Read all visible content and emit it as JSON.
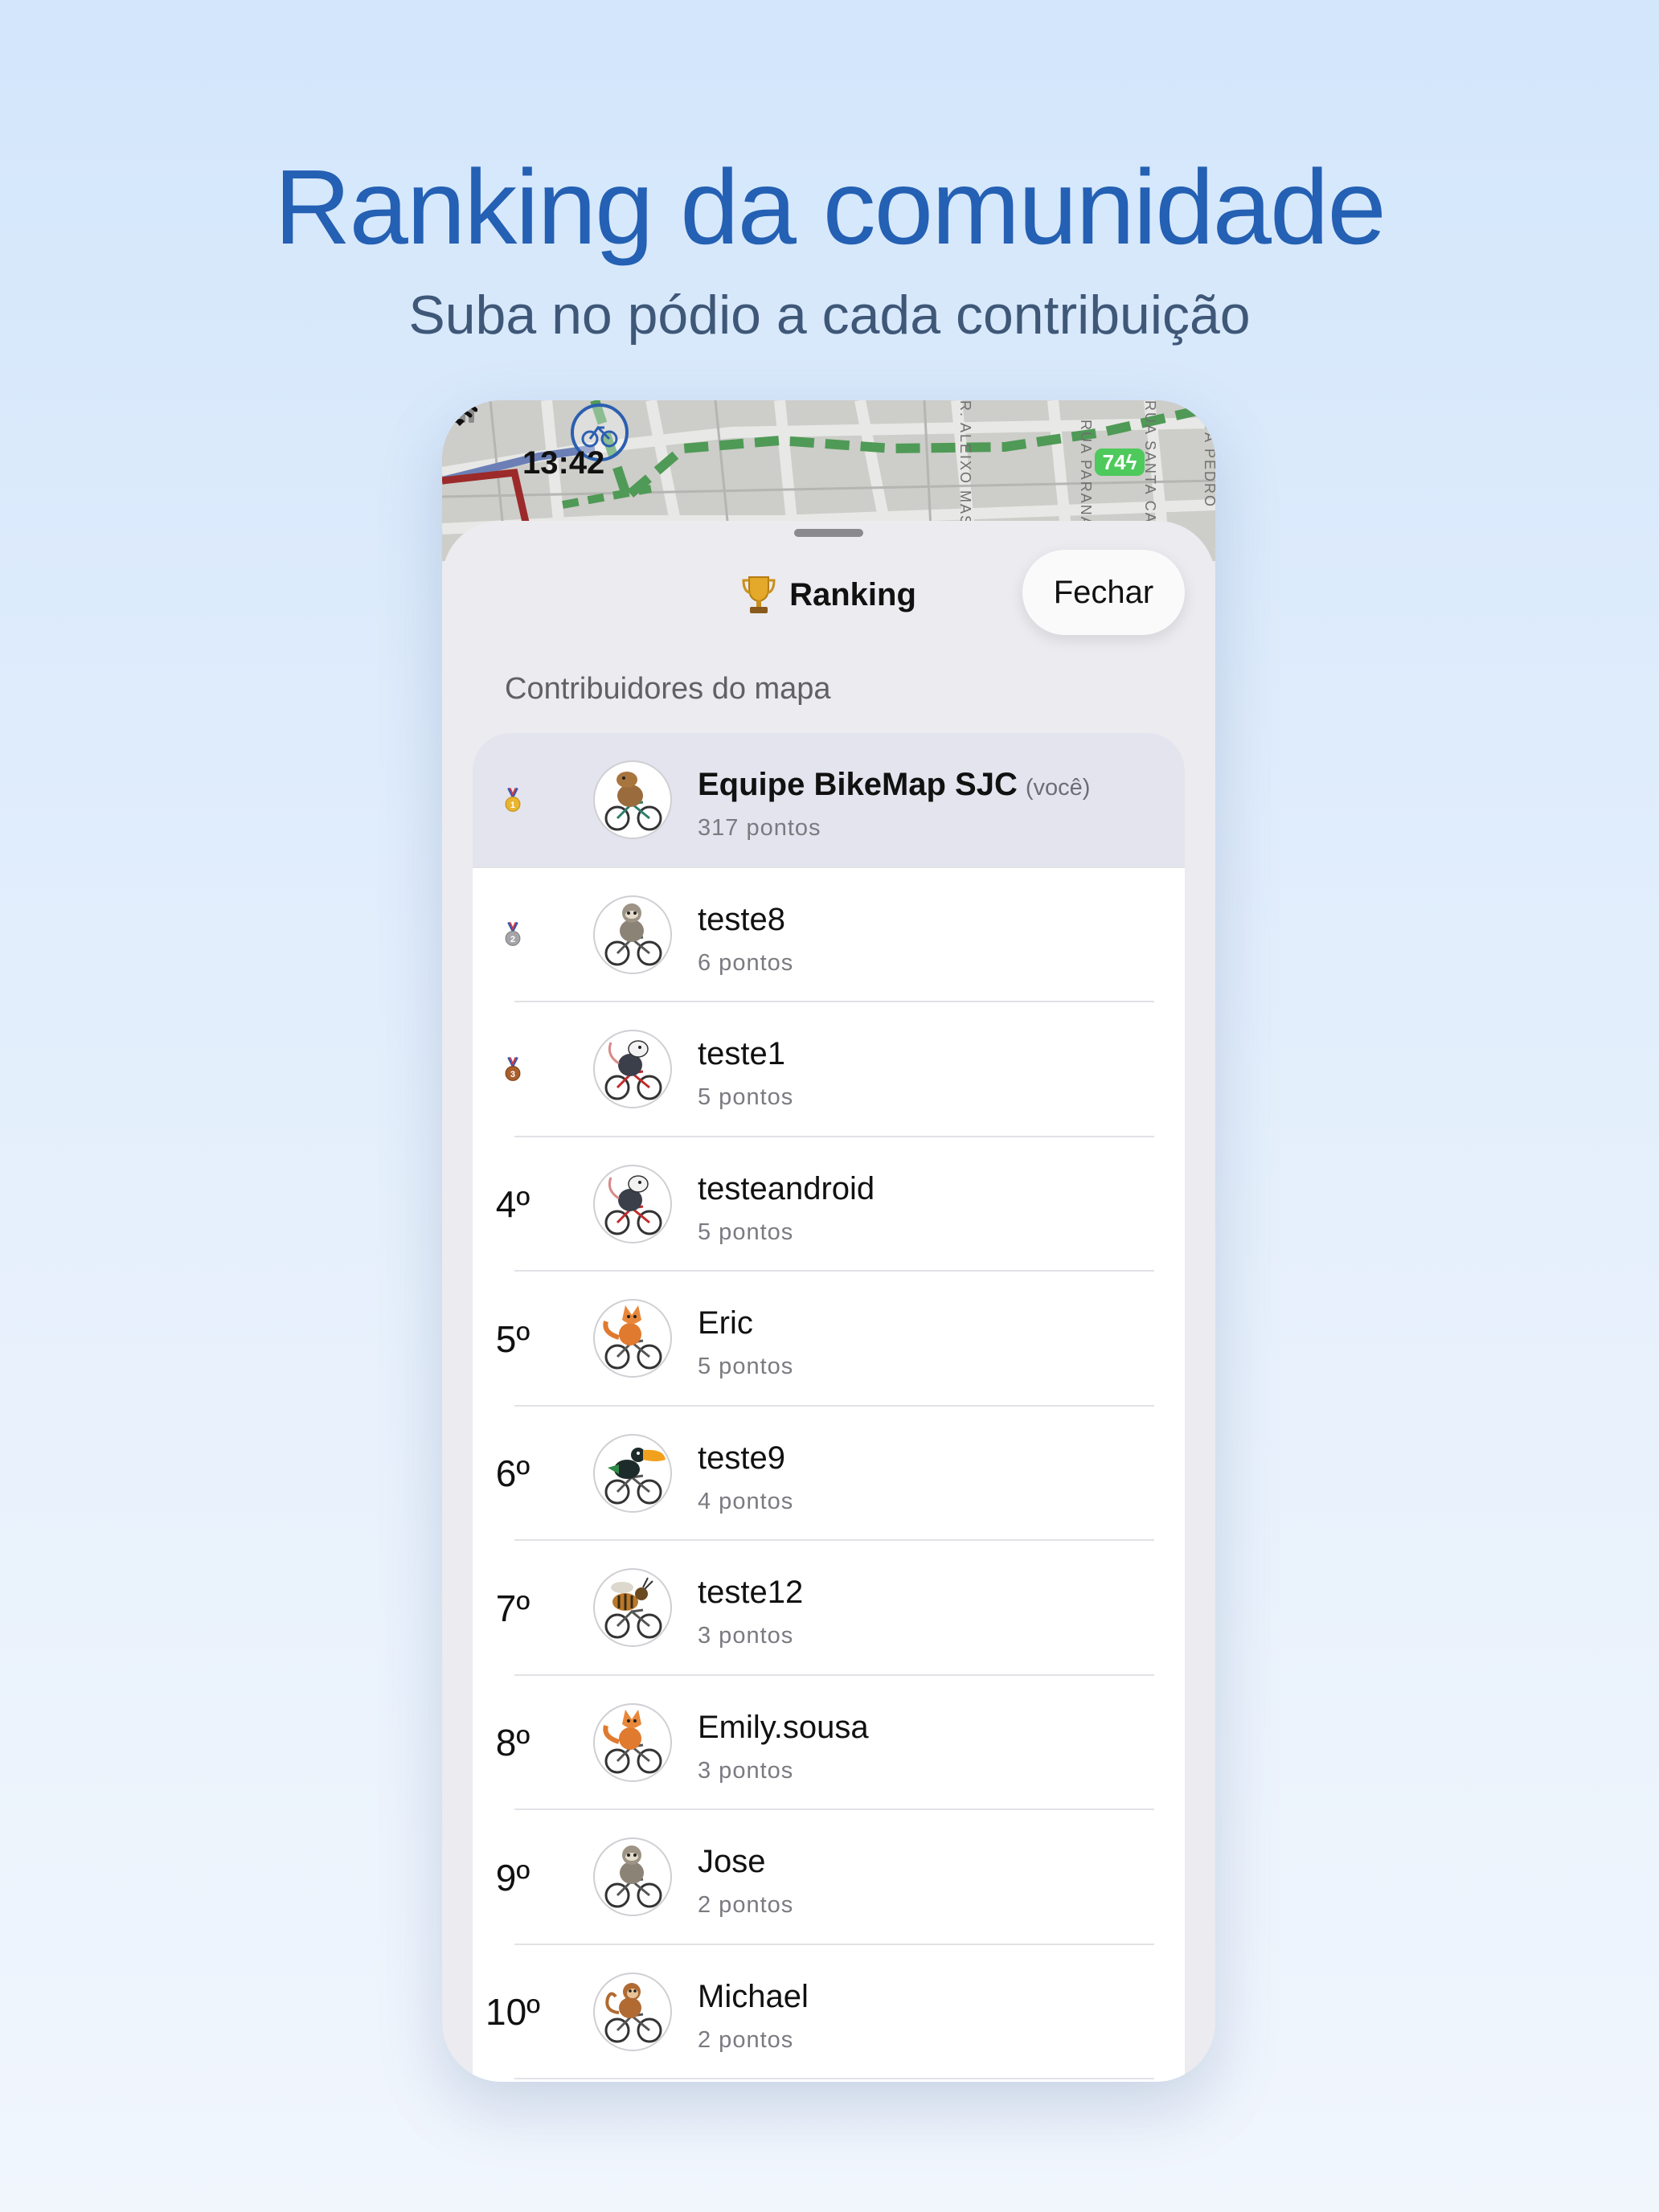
{
  "hero": {
    "title": "Ranking da comunidade",
    "subtitle": "Suba no pódio a cada contribuição"
  },
  "status_bar": {
    "time": "13:42",
    "battery": "74",
    "icons": [
      "location-arrow-icon",
      "cellular-signal-icon",
      "wifi-icon",
      "battery-charging-icon"
    ]
  },
  "map": {
    "street_labels": [
      "R. ALEIXO MAS",
      "RUA PARANÁ",
      "RUA SANTA CATA",
      "RUA PEDRO"
    ]
  },
  "sheet": {
    "title": "Ranking",
    "title_icon": "trophy-icon",
    "close_label": "Fechar",
    "section_header": "Contribuidores do mapa"
  },
  "colors": {
    "accent": "#2460b3",
    "you_row": "#e4e4ee",
    "gold": "#e9b531",
    "silver": "#a5a5a8",
    "bronze": "#a95e2c"
  },
  "rows": [
    {
      "rank": "",
      "medal": "1",
      "name": "Equipe BikeMap SJC",
      "you": "(você)",
      "points": "317 pontos",
      "avatar": "capybara-cyclist"
    },
    {
      "rank": "",
      "medal": "2",
      "name": "teste8",
      "points": "6 pontos",
      "avatar": "sloth-cyclist"
    },
    {
      "rank": "",
      "medal": "3",
      "name": "teste1",
      "points": "5 pontos",
      "avatar": "opossum-cyclist"
    },
    {
      "rank": "4º",
      "name": "testeandroid",
      "points": "5 pontos",
      "avatar": "opossum-cyclist"
    },
    {
      "rank": "5º",
      "name": "Eric",
      "points": "5 pontos",
      "avatar": "fox-cyclist"
    },
    {
      "rank": "6º",
      "name": "teste9",
      "points": "4 pontos",
      "avatar": "toucan-cyclist"
    },
    {
      "rank": "7º",
      "name": "teste12",
      "points": "3 pontos",
      "avatar": "bee-cyclist"
    },
    {
      "rank": "8º",
      "name": "Emily.sousa",
      "points": "3 pontos",
      "avatar": "fox-cyclist"
    },
    {
      "rank": "9º",
      "name": "Jose",
      "points": "2 pontos",
      "avatar": "sloth-cyclist"
    },
    {
      "rank": "10º",
      "name": "Michael",
      "points": "2 pontos",
      "avatar": "monkey-cyclist"
    }
  ]
}
